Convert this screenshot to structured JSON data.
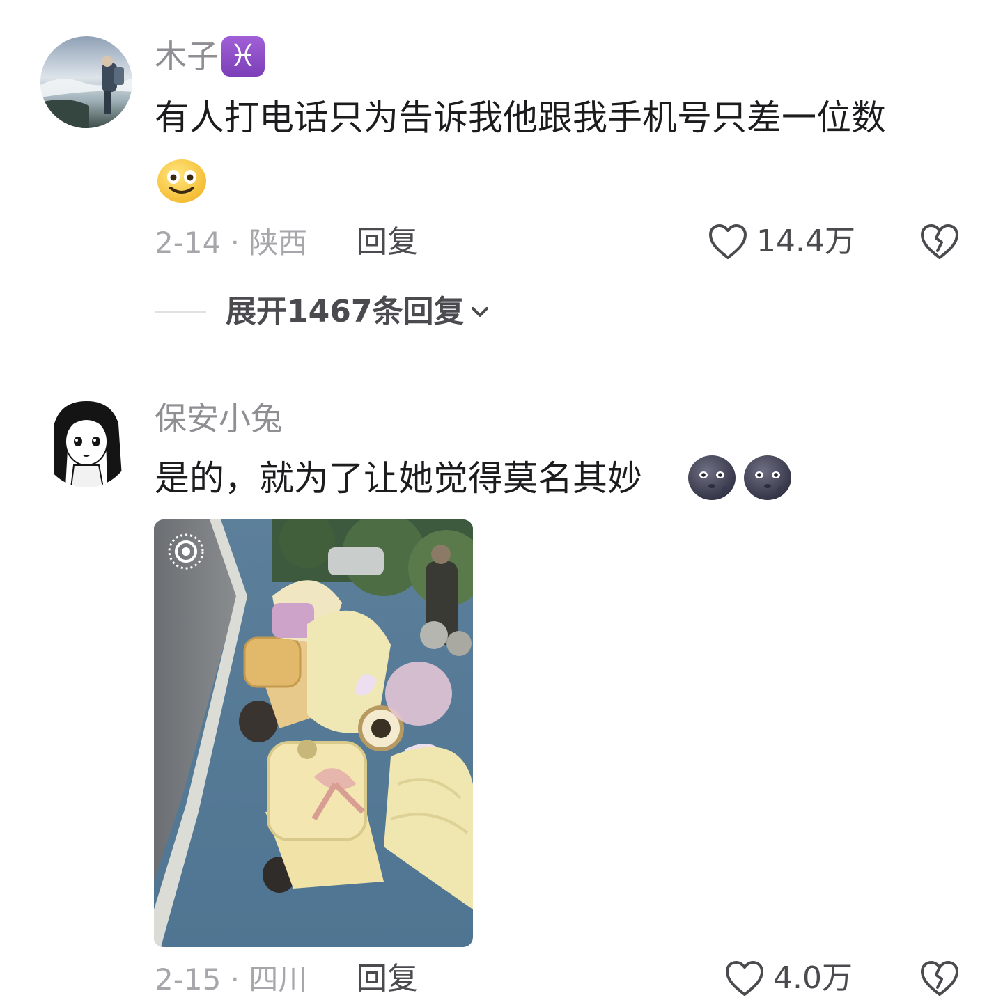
{
  "comments": [
    {
      "username": "木子",
      "zodiac_badge": "♓",
      "text": "有人打电话只为告诉我他跟我手机号只差一位数",
      "emoji": "smile-face",
      "date_location": "2-14 · 陕西",
      "reply_label": "回复",
      "likes": "14.4万",
      "expand_replies": "展开1467条回复"
    },
    {
      "username": "保安小兔",
      "text": "是的，就为了让她觉得莫名其妙",
      "emojis": [
        "dark-moon-face",
        "dark-moon-face"
      ],
      "date_location": "2-15 · 四川",
      "reply_label": "回复",
      "likes": "4.0万"
    }
  ],
  "colors": {
    "username": "#8e8e93",
    "text": "#1c1c1e",
    "meta": "#a6a6ab",
    "action": "#4a4a4f",
    "badge": "#8e4ac7"
  },
  "icons": {
    "like": "heart-outline-icon",
    "dislike": "broken-heart-icon",
    "expand": "chevron-down-icon",
    "live_photo": "live-photo-icon"
  }
}
